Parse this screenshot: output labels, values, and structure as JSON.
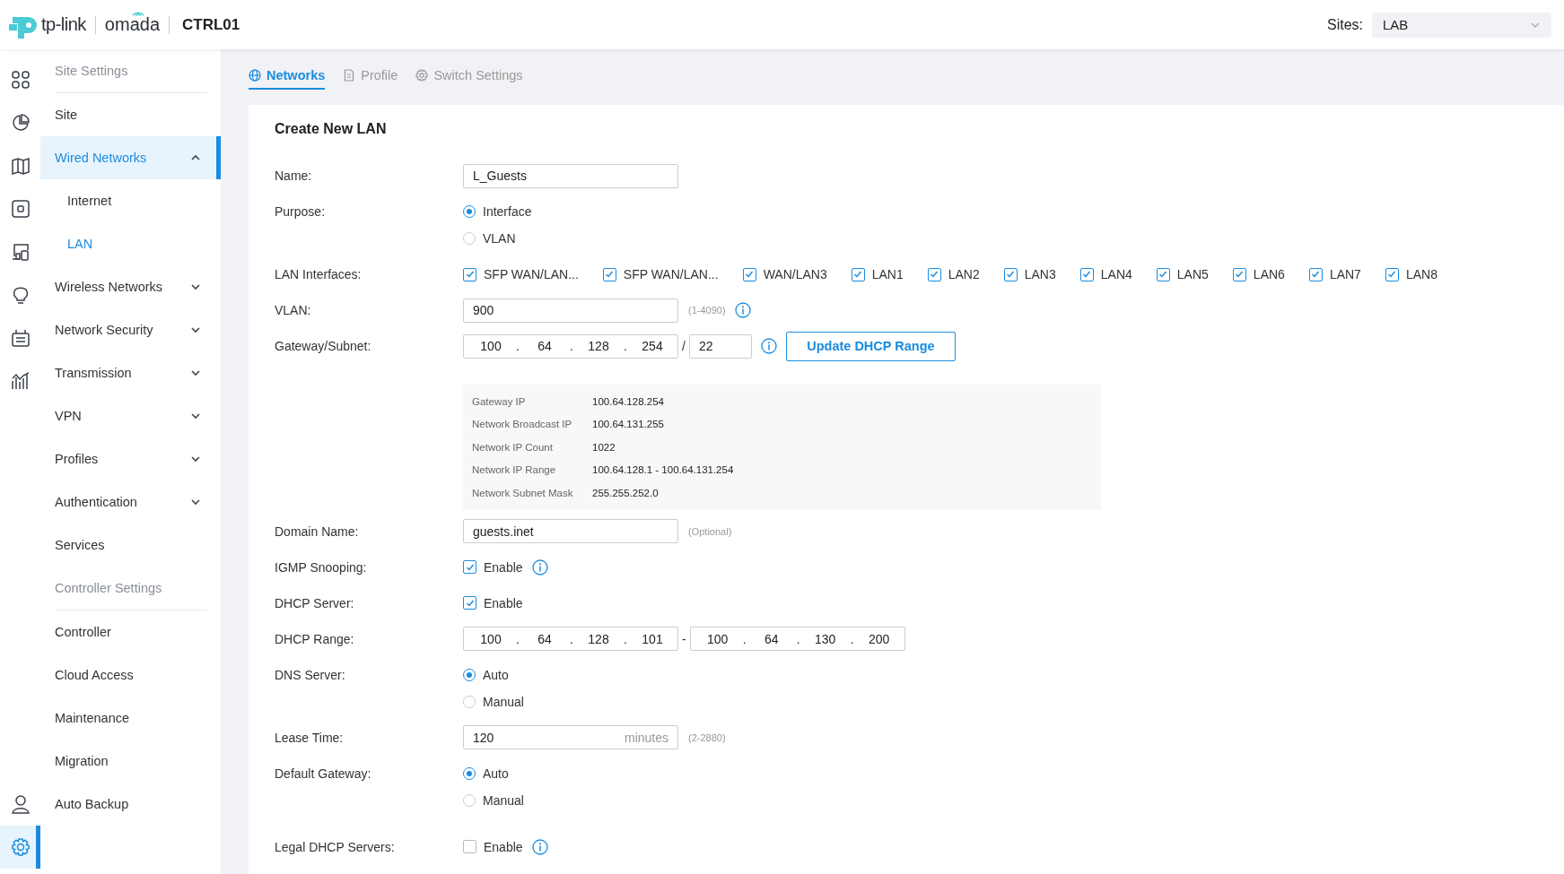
{
  "header": {
    "brand": "tp-link",
    "product": "omada",
    "controller": "CTRL01",
    "sites_label": "Sites:",
    "site": "LAB"
  },
  "rail": {
    "top": [
      {
        "selected": false
      },
      {
        "selected": false
      },
      {
        "selected": false
      },
      {
        "selected": false
      },
      {
        "selected": false
      },
      {
        "selected": false
      },
      {
        "selected": false
      },
      {
        "selected": false
      }
    ],
    "bottom": [
      {
        "selected": false
      },
      {
        "selected": true
      }
    ]
  },
  "sidebar": [
    {
      "heading": "Site Settings",
      "items": [
        {
          "label": "Site",
          "selected": false
        },
        {
          "label": "Wired Networks",
          "selected": true,
          "expanded": true,
          "children": [
            {
              "label": "Internet",
              "selected": false
            },
            {
              "label": "LAN",
              "selected": true
            }
          ]
        },
        {
          "label": "Wireless Networks",
          "selected": false,
          "expanded": false
        },
        {
          "label": "Network Security",
          "selected": false,
          "expanded": false
        },
        {
          "label": "Transmission",
          "selected": false,
          "expanded": false
        },
        {
          "label": "VPN",
          "selected": false,
          "expanded": false
        },
        {
          "label": "Profiles",
          "selected": false,
          "expanded": false
        },
        {
          "label": "Authentication",
          "selected": false,
          "expanded": false
        },
        {
          "label": "Services",
          "selected": false
        }
      ]
    },
    {
      "heading": "Controller Settings",
      "items": [
        {
          "label": "Controller",
          "selected": false
        },
        {
          "label": "Cloud Access",
          "selected": false
        },
        {
          "label": "Maintenance",
          "selected": false
        },
        {
          "label": "Migration",
          "selected": false
        },
        {
          "label": "Auto Backup",
          "selected": false
        }
      ]
    }
  ],
  "tabs": [
    {
      "label": "Networks",
      "selected": true
    },
    {
      "label": "Profile",
      "selected": false
    },
    {
      "label": "Switch Settings",
      "selected": false
    }
  ],
  "form": {
    "title": "Create New LAN",
    "fields": [
      {
        "kind": "text",
        "label": "Name:",
        "value": "L_Guests"
      },
      {
        "kind": "radio",
        "label": "Purpose:",
        "options": [
          {
            "label": "Interface",
            "selected": true
          },
          {
            "label": "VLAN",
            "selected": false
          }
        ]
      },
      {
        "kind": "checks",
        "label": "LAN Interfaces:",
        "options": [
          {
            "label": "SFP WAN/LAN...",
            "checked": true
          },
          {
            "label": "SFP WAN/LAN...",
            "checked": true
          },
          {
            "label": "WAN/LAN3",
            "checked": true
          },
          {
            "label": "LAN1",
            "checked": true
          },
          {
            "label": "LAN2",
            "checked": true
          },
          {
            "label": "LAN3",
            "checked": true
          },
          {
            "label": "LAN4",
            "checked": true
          },
          {
            "label": "LAN5",
            "checked": true
          },
          {
            "label": "LAN6",
            "checked": true
          },
          {
            "label": "LAN7",
            "checked": true
          },
          {
            "label": "LAN8",
            "checked": true
          }
        ]
      },
      {
        "kind": "text",
        "label": "VLAN:",
        "value": "900",
        "hint": "(1-4090)",
        "info": true
      },
      {
        "kind": "subnet",
        "label": "Gateway/Subnet:",
        "octets": [
          "100",
          "64",
          "128",
          "254"
        ],
        "separator": ".",
        "slash": "/",
        "mask": "22",
        "info": true,
        "button": "Update DHCP Range"
      },
      {
        "kind": "summary",
        "rows": [
          {
            "name": "Gateway IP",
            "value": "100.64.128.254"
          },
          {
            "name": "Network Broadcast IP",
            "value": "100.64.131.255"
          },
          {
            "name": "Network IP Count",
            "value": "1022"
          },
          {
            "name": "Network IP Range",
            "value": "100.64.128.1 - 100.64.131.254"
          },
          {
            "name": "Network Subnet Mask",
            "value": "255.255.252.0"
          }
        ]
      },
      {
        "kind": "text",
        "label": "Domain Name:",
        "value": "guests.inet",
        "hint": "(Optional)"
      },
      {
        "kind": "check",
        "label": "IGMP Snooping:",
        "option": "Enable",
        "checked": true,
        "info": true
      },
      {
        "kind": "check",
        "label": "DHCP Server:",
        "option": "Enable",
        "checked": true
      },
      {
        "kind": "range",
        "label": "DHCP Range:",
        "start": [
          "100",
          "64",
          "128",
          "101"
        ],
        "end": [
          "100",
          "64",
          "130",
          "200"
        ],
        "separator": ".",
        "dash": "-"
      },
      {
        "kind": "radio",
        "label": "DNS Server:",
        "options": [
          {
            "label": "Auto",
            "selected": true
          },
          {
            "label": "Manual",
            "selected": false
          }
        ]
      },
      {
        "kind": "unit",
        "label": "Lease Time:",
        "value": "120",
        "unit": "minutes",
        "hint": "(2-2880)"
      },
      {
        "kind": "radio",
        "label": "Default Gateway:",
        "options": [
          {
            "label": "Auto",
            "selected": true
          },
          {
            "label": "Manual",
            "selected": false
          }
        ]
      },
      {
        "kind": "check",
        "label": "Legal DHCP Servers:",
        "option": "Enable",
        "checked": false,
        "info": true,
        "spaced": true
      }
    ]
  }
}
